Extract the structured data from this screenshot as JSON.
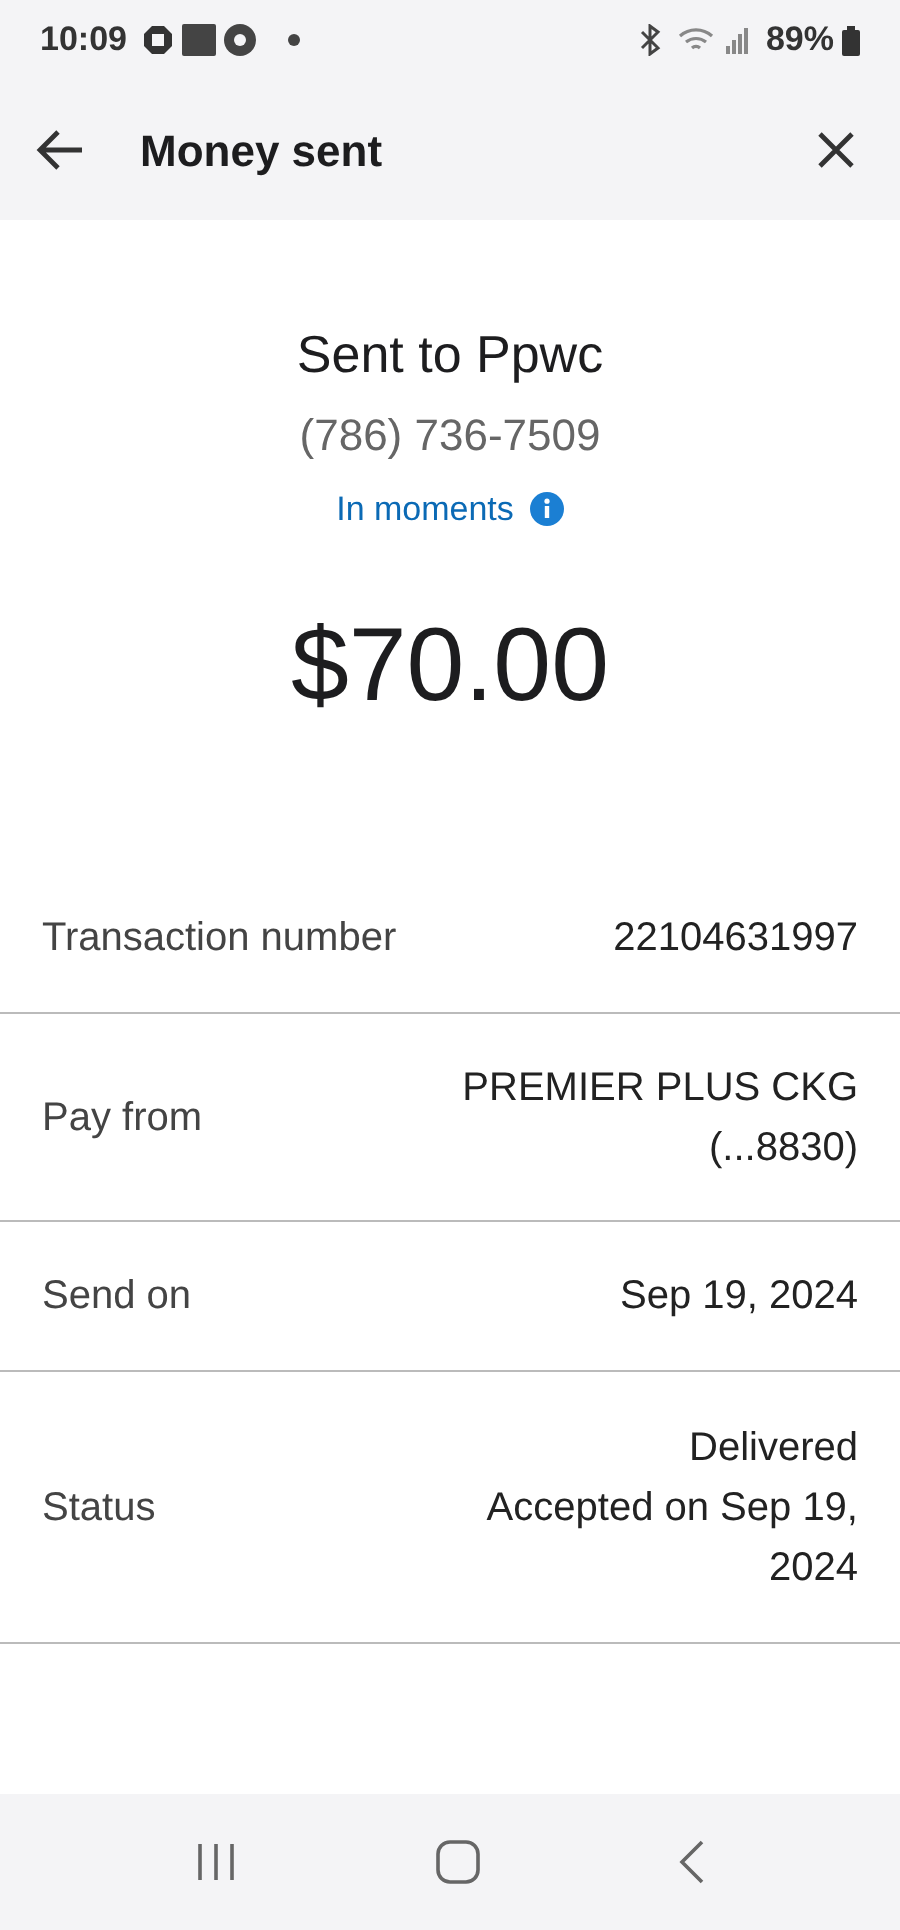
{
  "status_bar": {
    "time": "10:09",
    "battery": "89%"
  },
  "header": {
    "title": "Money sent"
  },
  "summary": {
    "recipient": "Sent to Ppwc",
    "phone": "(786) 736-7509",
    "timing": "In moments",
    "amount": "$70.00"
  },
  "details": [
    {
      "label": "Transaction number",
      "value": [
        "22104631997"
      ]
    },
    {
      "label": "Pay from",
      "value": [
        "PREMIER PLUS CKG",
        "(...8830)"
      ]
    },
    {
      "label": "Send on",
      "value": [
        "Sep 19, 2024"
      ]
    },
    {
      "label": "Status",
      "value": [
        "Delivered",
        "Accepted on Sep 19, 2024"
      ]
    }
  ]
}
